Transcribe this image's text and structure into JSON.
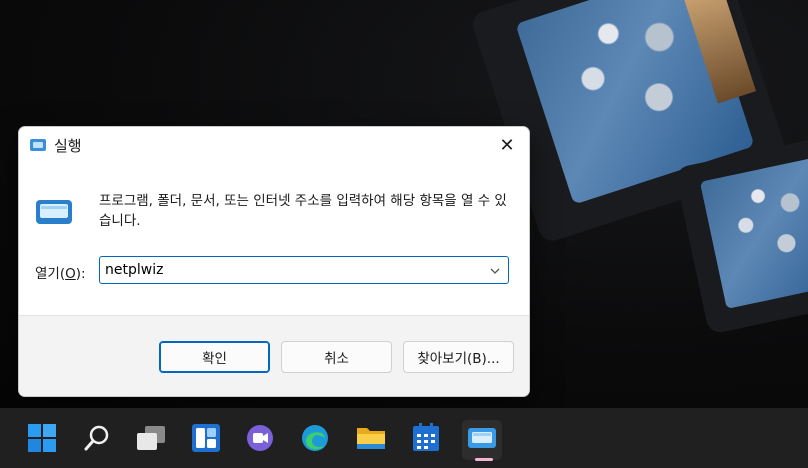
{
  "dialog": {
    "title": "실행",
    "close_glyph": "✕",
    "description": "프로그램, 폴더, 문서, 또는 인터넷 주소를 입력하여 해당 항목을 열 수 있습니다.",
    "open_label_prefix": "열기(",
    "open_label_accel": "O",
    "open_label_suffix": "):",
    "input_value": "netplwiz",
    "buttons": {
      "ok": "확인",
      "cancel": "취소",
      "browse": "찾아보기(B)..."
    }
  },
  "taskbar": {
    "items": [
      {
        "icon": "windows-start-icon"
      },
      {
        "icon": "search-icon"
      },
      {
        "icon": "task-view-icon"
      },
      {
        "icon": "widgets-icon"
      },
      {
        "icon": "chat-icon"
      },
      {
        "icon": "edge-icon"
      },
      {
        "icon": "file-explorer-icon"
      },
      {
        "icon": "calendar-app-icon"
      },
      {
        "icon": "run-app-icon",
        "active": true
      }
    ]
  },
  "colors": {
    "accent": "#0067c0",
    "taskbar": "#202020",
    "active_indicator": "#f2b6d3"
  }
}
